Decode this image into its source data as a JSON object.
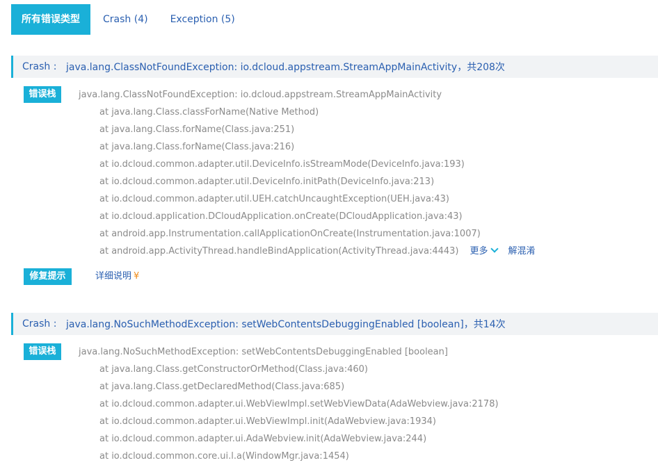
{
  "tabs": [
    {
      "label": "所有错误类型"
    },
    {
      "label": "Crash (4)"
    },
    {
      "label": "Exception (5)"
    }
  ],
  "crashes": [
    {
      "type_label": "Crash :",
      "title": "java.lang.ClassNotFoundException: io.dcloud.appstream.StreamAppMainActivity，共208次",
      "stack_badge": "错误栈",
      "stack_head": "java.lang.ClassNotFoundException: io.dcloud.appstream.StreamAppMainActivity",
      "stack_lines": [
        "at java.lang.Class.classForName(Native Method)",
        "at java.lang.Class.forName(Class.java:251)",
        "at java.lang.Class.forName(Class.java:216)",
        "at io.dcloud.common.adapter.util.DeviceInfo.isStreamMode(DeviceInfo.java:193)",
        "at io.dcloud.common.adapter.util.DeviceInfo.initPath(DeviceInfo.java:213)",
        "at io.dcloud.common.adapter.util.UEH.catchUncaughtException(UEH.java:43)",
        "at io.dcloud.application.DCloudApplication.onCreate(DCloudApplication.java:43)",
        "at android.app.Instrumentation.callApplicationOnCreate(Instrumentation.java:1007)",
        "at android.app.ActivityThread.handleBindApplication(ActivityThread.java:4443)"
      ],
      "more_label": "更多",
      "deobfuscate_label": "解混淆",
      "fix_badge": "修复提示",
      "fix_link": "详细说明",
      "fix_yen": "¥"
    },
    {
      "type_label": "Crash :",
      "title": "java.lang.NoSuchMethodException: setWebContentsDebuggingEnabled [boolean]，共14次",
      "stack_badge": "错误栈",
      "stack_head": "java.lang.NoSuchMethodException: setWebContentsDebuggingEnabled [boolean]",
      "stack_lines": [
        "at java.lang.Class.getConstructorOrMethod(Class.java:460)",
        "at java.lang.Class.getDeclaredMethod(Class.java:685)",
        "at io.dcloud.common.adapter.ui.WebViewImpl.setWebViewData(AdaWebview.java:2178)",
        "at io.dcloud.common.adapter.ui.WebViewImpl.init(AdaWebview.java:1934)",
        "at io.dcloud.common.adapter.ui.AdaWebview.init(AdaWebview.java:244)",
        "at io.dcloud.common.core.ui.l.a(WindowMgr.java:1454)"
      ]
    }
  ],
  "colors": {
    "accent": "#1ab0d8",
    "link": "#2a5fb0",
    "header_bg": "#f1f3f5",
    "stack_text": "#8a8a8a",
    "yen": "#f08c1a"
  }
}
